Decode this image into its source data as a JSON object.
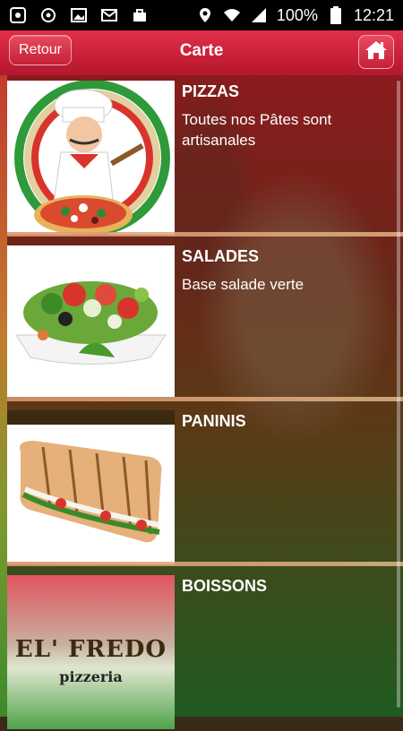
{
  "status_bar": {
    "battery": "100%",
    "time": "12:21"
  },
  "app_bar": {
    "back_label": "Retour",
    "title": "Carte"
  },
  "menu": [
    {
      "title": "PIZZAS",
      "description": "Toutes nos Pâtes sont artisanales"
    },
    {
      "title": "SALADES",
      "description": "Base salade verte"
    },
    {
      "title": "PANINIS",
      "description": ""
    },
    {
      "title": "BOISSONS",
      "description": ""
    }
  ],
  "logo": {
    "brand": "EL' FREDO",
    "subtitle": "pizzeria"
  }
}
